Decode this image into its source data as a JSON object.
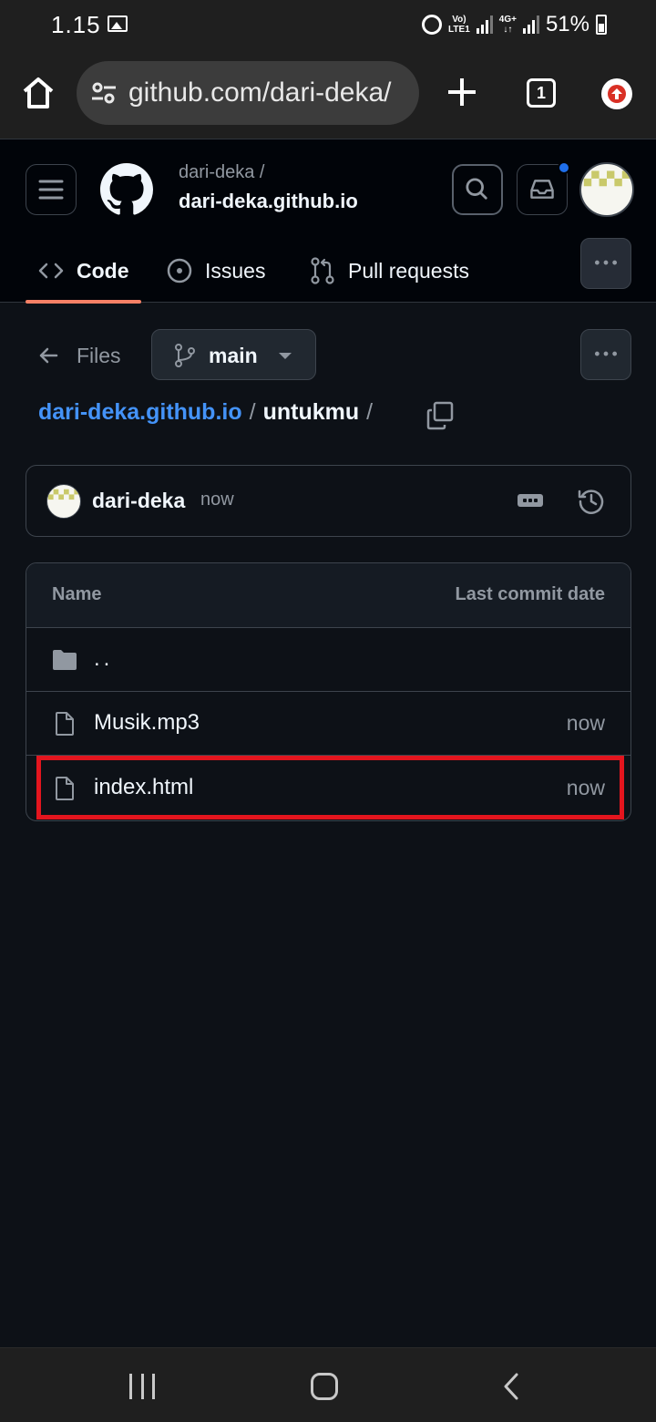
{
  "status_bar": {
    "time": "1.15",
    "network_top": "Vo)",
    "network_bottom": "LTE1",
    "network2_top": "4G+",
    "network2_bottom": "↓↑",
    "battery": "51%"
  },
  "browser": {
    "url": "github.com/dari-deka/",
    "tab_count": "1"
  },
  "header": {
    "owner": "dari-deka /",
    "repo": "dari-deka.github.io"
  },
  "tabs": [
    {
      "label": "Code",
      "active": true
    },
    {
      "label": "Issues",
      "active": false
    },
    {
      "label": "Pull requests",
      "active": false
    }
  ],
  "toolbar": {
    "files_label": "Files",
    "branch": "main"
  },
  "breadcrumb": {
    "repo": "dari-deka.github.io",
    "separator": "/",
    "current": "untukmu",
    "trailing": "/"
  },
  "commit": {
    "author": "dari-deka",
    "time": "now"
  },
  "table": {
    "col_name": "Name",
    "col_date": "Last commit date",
    "rows": [
      {
        "type": "folder",
        "name": "..",
        "date": ""
      },
      {
        "type": "file",
        "name": "Musik.mp3",
        "date": "now"
      },
      {
        "type": "file",
        "name": "index.html",
        "date": "now",
        "highlighted": true
      }
    ]
  },
  "colors": {
    "accent_link": "#4493f8",
    "tab_underline": "#f78166",
    "highlight_box": "#e3151e",
    "background": "#0d1117"
  }
}
